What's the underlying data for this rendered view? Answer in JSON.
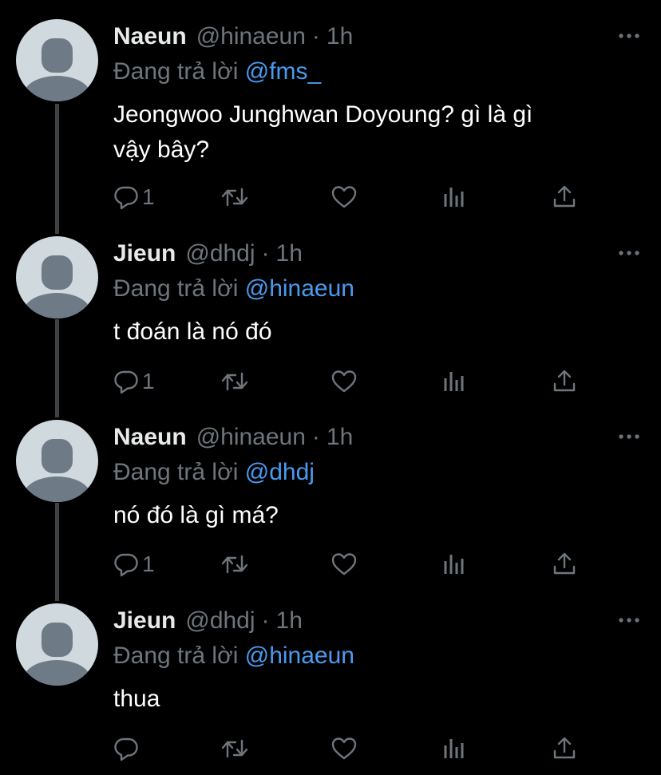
{
  "tweets": [
    {
      "name": "Naeun",
      "handle": "@hinaeun",
      "separator": "·",
      "time": "1h",
      "replying_prefix": "Đang trả lời",
      "replying_to": "@fms_",
      "text": "Jeongwoo Junghwan Doyoung? gì là gì\nvậy bây?",
      "reply_count": "1"
    },
    {
      "name": "Jieun",
      "handle": "@dhdj",
      "separator": "·",
      "time": "1h",
      "replying_prefix": "Đang trả lời",
      "replying_to": "@hinaeun",
      "text": "t đoán là nó đó",
      "reply_count": "1"
    },
    {
      "name": "Naeun",
      "handle": "@hinaeun",
      "separator": "·",
      "time": "1h",
      "replying_prefix": "Đang trả lời",
      "replying_to": "@dhdj",
      "text": "nó đó là gì má?",
      "reply_count": "1"
    },
    {
      "name": "Jieun",
      "handle": "@dhdj",
      "separator": "·",
      "time": "1h",
      "replying_prefix": "Đang trả lời",
      "replying_to": "@hinaeun",
      "text": "thua",
      "reply_count": ""
    }
  ],
  "icons": {
    "more": "more-horizontal-icon",
    "reply": "reply-bubble-icon",
    "retweet": "retweet-icon",
    "like": "heart-icon",
    "stats": "bar-chart-icon",
    "share": "share-icon"
  },
  "colors": {
    "background": "#000000",
    "muted": "#6e767d",
    "mention": "#4a9bf0",
    "text": "#ffffff",
    "avatar_bg": "#cfd9de",
    "avatar_fg": "#6e7a86",
    "thread_line": "#3e4144"
  }
}
